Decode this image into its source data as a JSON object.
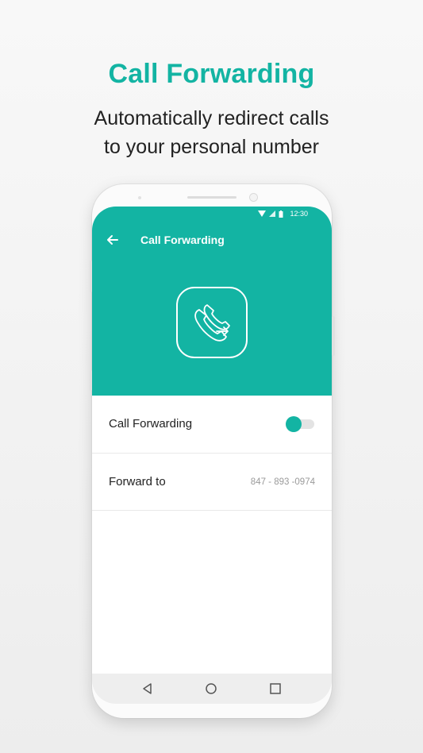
{
  "promo": {
    "headline": "Call Forwarding",
    "subline_1": "Automatically redirect calls",
    "subline_2": "to your personal number"
  },
  "status_bar": {
    "time": "12:30",
    "icons": [
      "wifi-icon",
      "signal-icon",
      "battery-icon"
    ]
  },
  "app_bar": {
    "back_icon": "arrow-left-icon",
    "title": "Call Forwarding"
  },
  "hero_icon": "call-forward-phone-icon",
  "settings": {
    "call_forwarding": {
      "label": "Call Forwarding",
      "enabled": true
    },
    "forward_to": {
      "label": "Forward to",
      "value": "847 - 893 -0974"
    }
  },
  "nav_bar": {
    "icons": [
      "back-triangle-icon",
      "home-circle-icon",
      "recents-square-icon"
    ]
  },
  "colors": {
    "accent": "#13b4a3",
    "toggle_track": "#e3e3e3",
    "text_primary": "#222222",
    "text_secondary": "#9a9a9a"
  }
}
